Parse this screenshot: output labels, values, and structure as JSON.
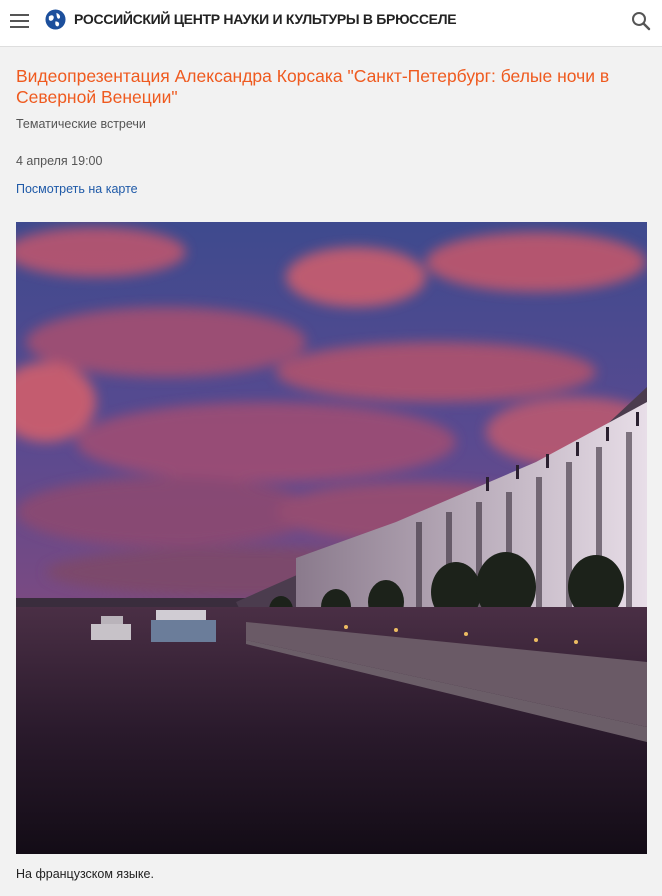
{
  "header": {
    "site_title": "РОССИЙСКИЙ ЦЕНТР НАУКИ И КУЛЬТУРЫ В БРЮССЕЛЕ",
    "menu_icon": "hamburger-menu-icon",
    "logo_icon": "globe-logo-icon",
    "search_icon": "search-icon"
  },
  "event": {
    "title": "Видеопрезентация Александра Корсака \"Санкт-Петербург: белые ночи в Северной Венеции\"",
    "category": "Тематические встречи",
    "datetime": "4 апреля 19:00",
    "map_link": "Посмотреть на карте",
    "caption": "На французском языке."
  },
  "colors": {
    "accent": "#ef5a1f",
    "link": "#1f5aa8",
    "logo_blue": "#1c4f9c"
  }
}
